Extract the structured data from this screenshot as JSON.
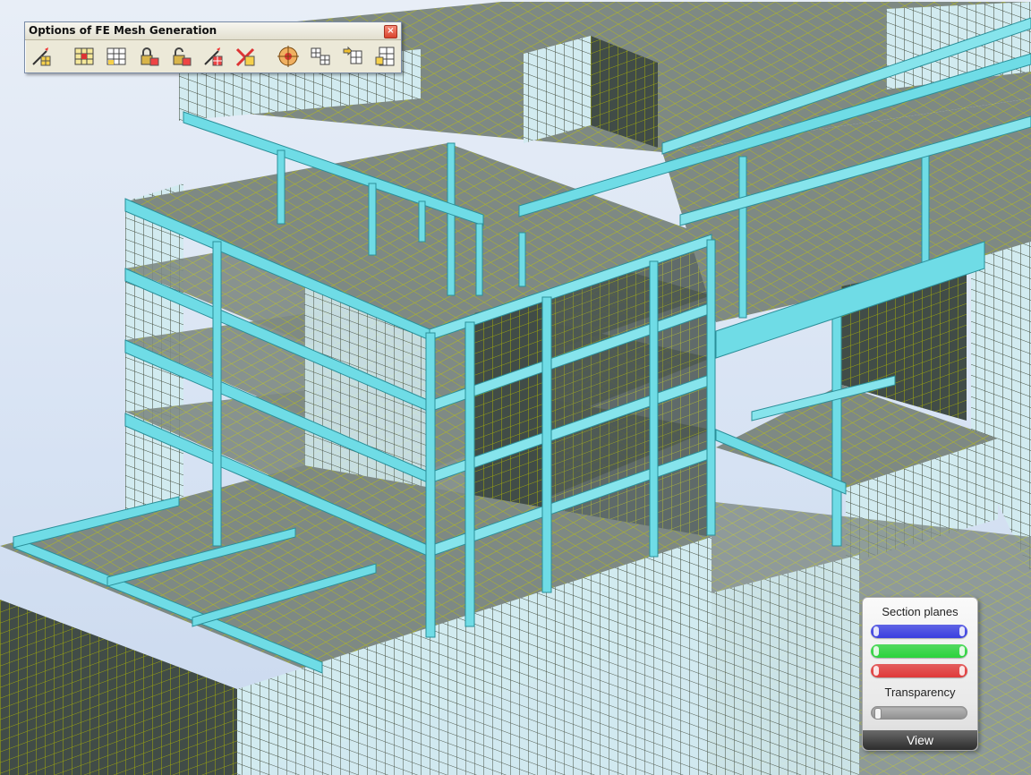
{
  "toolbar": {
    "title": "Options of FE Mesh Generation",
    "close_glyph": "×",
    "tools": [
      {
        "name": "mesh-generate-icon"
      },
      {
        "name": "mesh-panel-icon"
      },
      {
        "name": "mesh-delete-icon"
      },
      {
        "name": "mesh-lock-icon"
      },
      {
        "name": "mesh-unlock-icon"
      },
      {
        "name": "mesh-refine-icon"
      },
      {
        "name": "mesh-remove-icon"
      },
      {
        "name": "mesh-point-icon"
      },
      {
        "name": "mesh-emitter-icon"
      },
      {
        "name": "mesh-coons-icon"
      },
      {
        "name": "mesh-delaunay-icon"
      }
    ]
  },
  "section_panel": {
    "title": "Section planes",
    "planes": [
      {
        "name": "blue",
        "color": "#3a3fe0"
      },
      {
        "name": "green",
        "color": "#2bd33c"
      },
      {
        "name": "red",
        "color": "#e03a3a"
      }
    ],
    "transparency_label": "Transparency",
    "transparency_level": 0.0,
    "view_label": "View"
  },
  "colors": {
    "beam": "#6fdce6",
    "beam_dark": "#3aa9b5",
    "beam_shadow": "#1f6b73",
    "panel_light": "#c9eaf0",
    "panel_dark": "#3d4843",
    "mesh_line": "#a9b30a",
    "wall_face": "#7f8a85"
  }
}
